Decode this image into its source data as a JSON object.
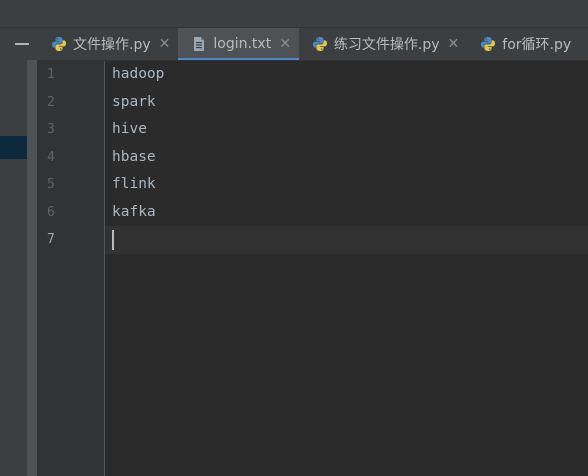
{
  "tabs": [
    {
      "label": "文件操作.py",
      "icon": "python-file-icon",
      "active": false,
      "closable": true
    },
    {
      "label": "login.txt",
      "icon": "text-file-icon",
      "active": true,
      "closable": true
    },
    {
      "label": "练习文件操作.py",
      "icon": "python-file-icon",
      "active": false,
      "closable": true
    },
    {
      "label": "for循环.py",
      "icon": "python-file-icon",
      "active": false,
      "closable": false
    }
  ],
  "close_glyph": "✕",
  "editor": {
    "line_numbers": [
      "1",
      "2",
      "3",
      "4",
      "5",
      "6",
      "7"
    ],
    "lines": [
      "hadoop",
      "spark",
      "hive",
      "hbase",
      "flink",
      "kafka",
      ""
    ],
    "current_line": 7
  },
  "colors": {
    "accent": "#4a88c7",
    "text": "#a9b7c6",
    "background": "#2b2b2b"
  }
}
